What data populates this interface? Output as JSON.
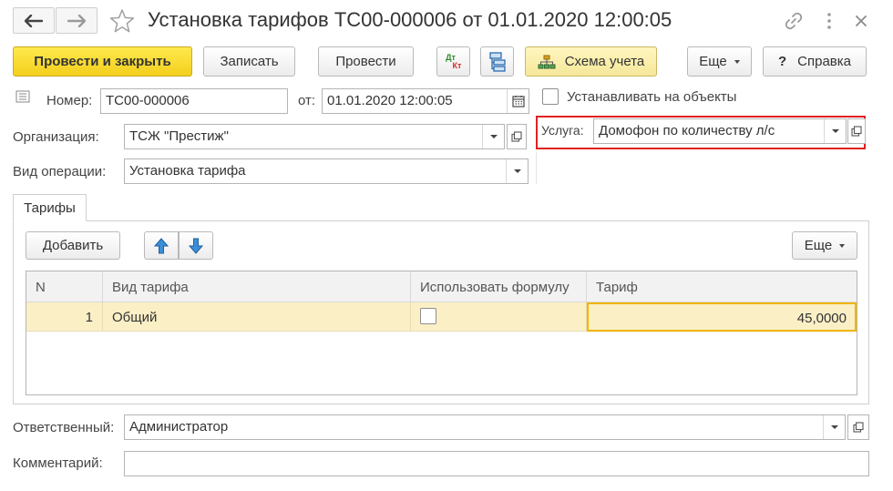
{
  "window": {
    "title": "Установка тарифов ТС00-000006 от 01.01.2020 12:00:05"
  },
  "toolbar": {
    "post_close_label": "Провести и закрыть",
    "save_label": "Записать",
    "post_label": "Провести",
    "dtkt_top": "Дт",
    "dtkt_bottom": "Кт",
    "scheme_label": "Схема учета",
    "more_label": "Еще",
    "help_q": "?",
    "help_label": "Справка"
  },
  "header": {
    "number_label": "Номер:",
    "number_value": "ТС00-000006",
    "date_label": "от:",
    "date_value": "01.01.2020 12:00:05",
    "set_objects_label": "Устанавливать на объекты",
    "org_label": "Организация:",
    "org_value": "ТСЖ \"Престиж\"",
    "service_label": "Услуга:",
    "service_value": "Домофон по количеству л/с",
    "operation_label": "Вид операции:",
    "operation_value": "Установка тарифа"
  },
  "tabs": [
    {
      "label": "Тарифы"
    }
  ],
  "tariffs": {
    "add_label": "Добавить",
    "more_label": "Еще",
    "columns": [
      "N",
      "Вид тарифа",
      "Использовать формулу",
      "Тариф"
    ],
    "rows": [
      {
        "n": "1",
        "type": "Общий",
        "use_formula": false,
        "tariff": "45,0000"
      }
    ]
  },
  "footer": {
    "responsible_label": "Ответственный:",
    "responsible_value": "Администратор",
    "comment_label": "Комментарий:",
    "comment_value": ""
  },
  "colors": {
    "primary_button": "#f3cf1d",
    "highlight_box": "#e02020",
    "selected_row": "#fbefc6",
    "active_cell_border": "#f0b400"
  },
  "icons": [
    "back-arrow-icon",
    "forward-arrow-icon",
    "star-icon",
    "link-icon",
    "more-vertical-icon",
    "close-icon",
    "dtkt-icon",
    "structure-icon",
    "scheme-icon",
    "calendar-icon",
    "open-form-icon",
    "move-up-icon",
    "move-down-icon",
    "dropdown-icon"
  ]
}
